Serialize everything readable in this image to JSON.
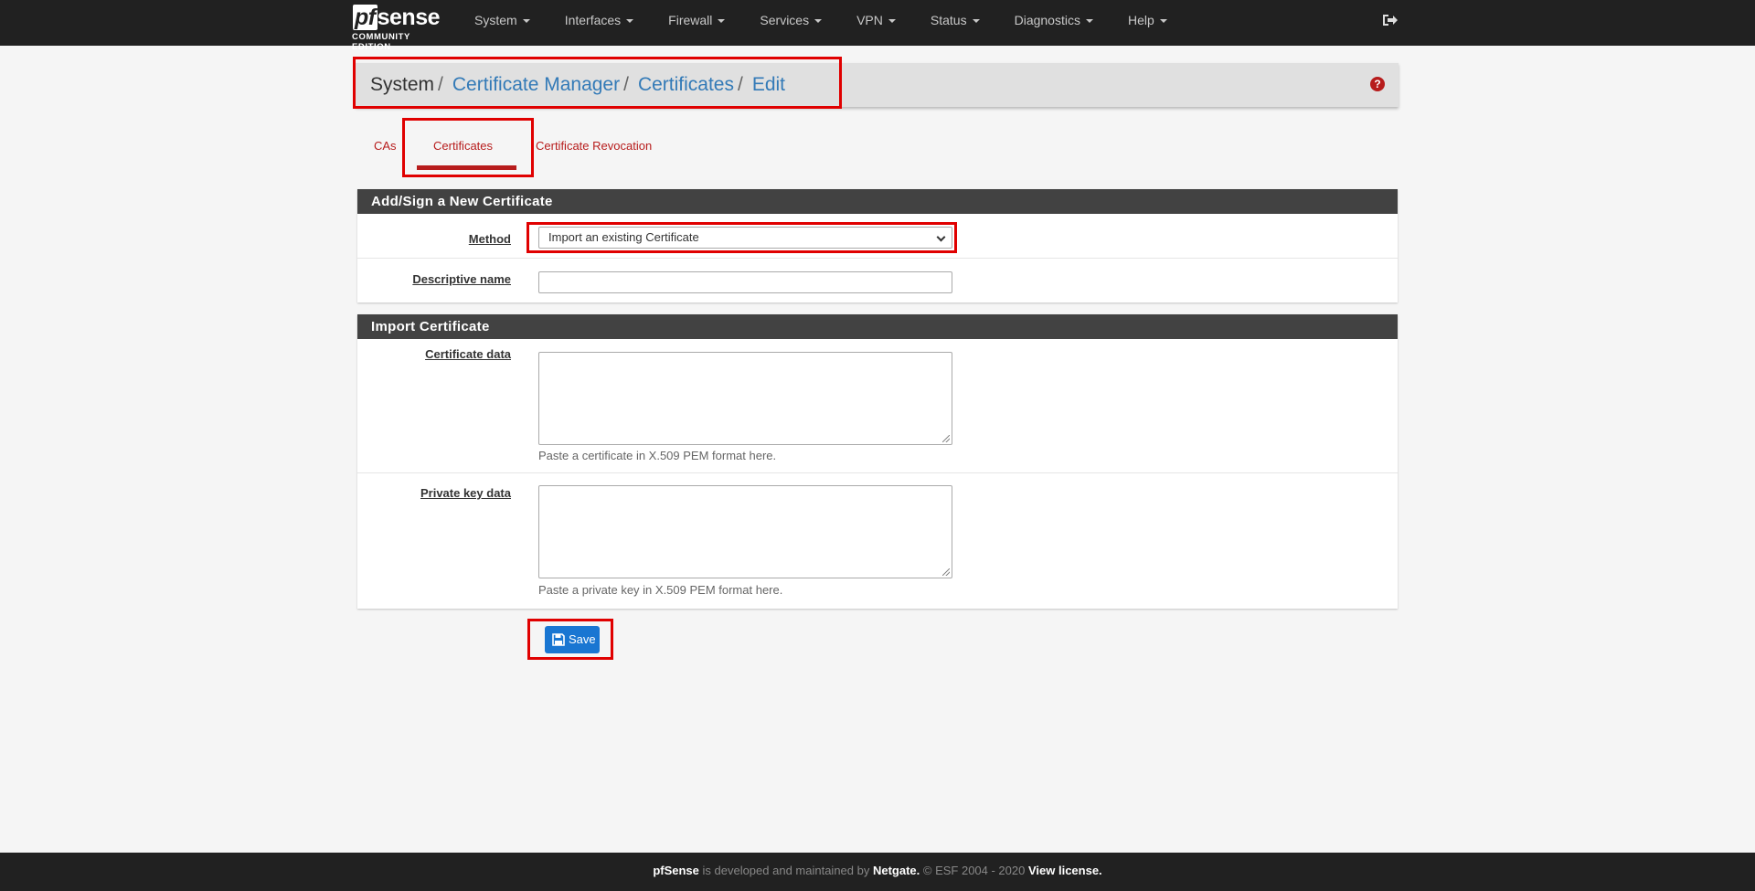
{
  "brand": {
    "logo": "sense",
    "logo_pf": "pf",
    "edition": "COMMUNITY EDITION"
  },
  "nav": [
    "System",
    "Interfaces",
    "Firewall",
    "Services",
    "VPN",
    "Status",
    "Diagnostics",
    "Help"
  ],
  "breadcrumb": {
    "root": "System",
    "links": [
      "Certificate Manager",
      "Certificates",
      "Edit"
    ],
    "separator": "/"
  },
  "tabs": [
    "CAs",
    "Certificates",
    "Certificate Revocation"
  ],
  "active_tab": "Certificates",
  "panels": {
    "add_sign": {
      "title": "Add/Sign a New Certificate",
      "method_label": "Method",
      "method_value": "Import an existing Certificate",
      "descr_label": "Descriptive name",
      "descr_value": ""
    },
    "import": {
      "title": "Import Certificate",
      "cert_label": "Certificate data",
      "cert_help": "Paste a certificate in X.509 PEM format here.",
      "key_label": "Private key data",
      "key_help": "Paste a private key in X.509 PEM format here."
    }
  },
  "save_label": "Save",
  "footer": {
    "product": "pfSense",
    "text1": " is developed and maintained by ",
    "company": "Netgate.",
    "text2": " © ESF 2004 - 2020 ",
    "license": "View license."
  },
  "colors": {
    "navbar": "#212121",
    "accent_red": "#b71c1c",
    "link_blue": "#337ab7",
    "button_blue": "#1976d2",
    "panel_heading": "#424242"
  },
  "icons": {
    "logout": "sign-out-icon",
    "help": "question-circle-icon",
    "save": "floppy-disk-icon"
  }
}
